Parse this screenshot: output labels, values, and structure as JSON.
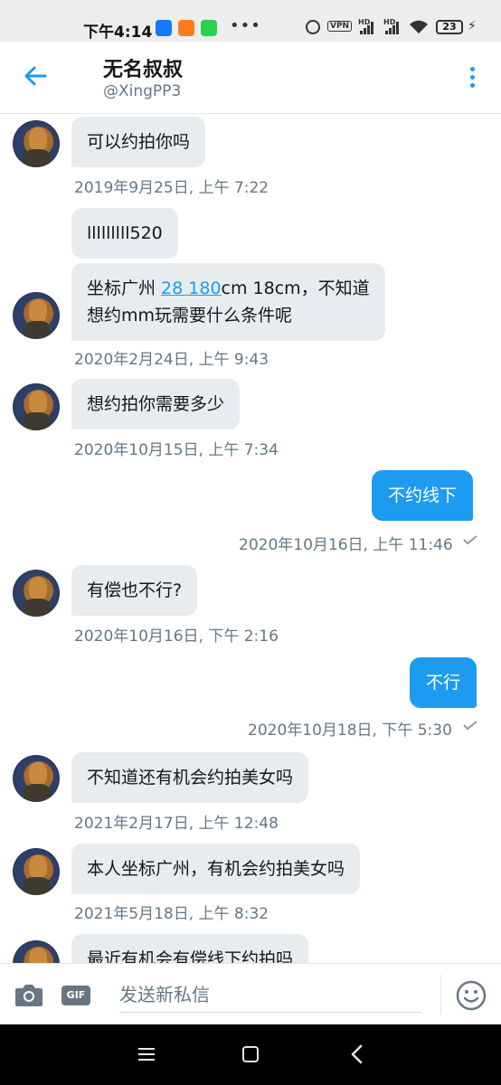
{
  "status_bar": {
    "time": "下午4:14",
    "vpn": "VPN",
    "hd1": "HD",
    "hd2": "HD",
    "battery": "23"
  },
  "header": {
    "name": "无名叔叔",
    "handle": "@XingPP3",
    "accent_color": "#1d9bf0"
  },
  "messages": [
    {
      "side": "in",
      "text": "可以约拍你吗",
      "time": "2019年9月25日, 上午 7:22"
    },
    {
      "side": "in",
      "text": "lllllllll520"
    },
    {
      "side": "in",
      "text_line1_prefix": "坐标广州 ",
      "link": "28 180",
      "text_line1_suffix": "cm 18cm，不知道",
      "text_line2": "想约mm玩需要什么条件呢",
      "time": "2020年2月24日, 上午 9:43"
    },
    {
      "side": "in",
      "text": "想约拍你需要多少",
      "time": "2020年10月15日, 上午 7:34"
    },
    {
      "side": "out",
      "text": "不约线下",
      "time": "2020年10月16日, 上午 11:46"
    },
    {
      "side": "in",
      "text": "有偿也不行?",
      "time": "2020年10月16日, 下午 2:16"
    },
    {
      "side": "out",
      "text": "不行",
      "time": "2020年10月18日, 下午 5:30"
    },
    {
      "side": "in",
      "text": "不知道还有机会约拍美女吗",
      "time": "2021年2月17日, 上午 12:48"
    },
    {
      "side": "in",
      "text": "本人坐标广州，有机会约拍美女吗",
      "time": "2021年5月18日, 上午 8:32"
    },
    {
      "side": "in",
      "text": "最近有机会有偿线下约拍吗"
    }
  ],
  "compose": {
    "placeholder": "发送新私信",
    "gif_label": "GIF"
  }
}
